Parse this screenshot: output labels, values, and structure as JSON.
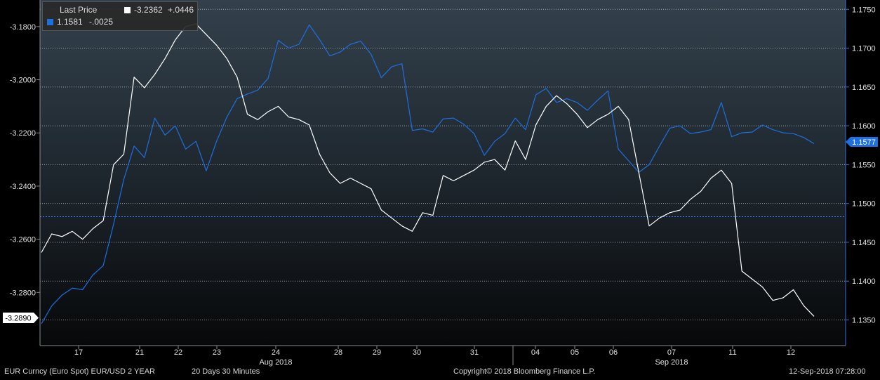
{
  "legend": {
    "title": "Last Price",
    "series": [
      {
        "color": "#ffffff",
        "last": "-3.2362",
        "change": "+.0446"
      },
      {
        "color": "#1e6fe0",
        "last": "1.1581",
        "change": "-.0025"
      }
    ]
  },
  "footer": {
    "ticker": "EUR Curncy (Euro Spot) EUR/USD 2 YEAR",
    "period": "20 Days 30 Minutes",
    "copyright": "Copyright© 2018 Bloomberg Finance L.P.",
    "timestamp": "12-Sep-2018 07:28:00"
  },
  "chart_data": {
    "type": "line",
    "x_ticks": [
      "17",
      "21",
      "22",
      "23",
      "24",
      "28",
      "29",
      "30",
      "31",
      "04",
      "05",
      "06",
      "07",
      "11",
      "12"
    ],
    "month_labels": [
      "Aug 2018",
      "Sep 2018"
    ],
    "left_axis": {
      "ylim": [
        -3.3,
        -3.17
      ],
      "ticks": [
        "-3.1800",
        "-3.2000",
        "-3.2200",
        "-3.2400",
        "-3.2600",
        "-3.2800"
      ]
    },
    "right_axis": {
      "ylim": [
        1.1317,
        1.1762
      ],
      "ticks": [
        "1.1750",
        "1.1700",
        "1.1650",
        "1.1600",
        "1.1550",
        "1.1500",
        "1.1450",
        "1.1400",
        "1.1350"
      ]
    },
    "badges": {
      "left_last": "-3.2890",
      "right_last": "1.1577"
    },
    "reference_line": 1.1483,
    "series": [
      {
        "axis": "left",
        "color": "#ffffff",
        "values": [
          -3.265,
          -3.258,
          -3.259,
          -3.257,
          -3.26,
          -3.256,
          -3.253,
          -3.232,
          -3.228,
          -3.199,
          -3.203,
          -3.198,
          -3.192,
          -3.185,
          -3.18,
          -3.179,
          -3.183,
          -3.187,
          -3.192,
          -3.199,
          -3.213,
          -3.215,
          -3.212,
          -3.21,
          -3.214,
          -3.215,
          -3.217,
          -3.228,
          -3.235,
          -3.239,
          -3.237,
          -3.239,
          -3.241,
          -3.249,
          -3.252,
          -3.255,
          -3.257,
          -3.25,
          -3.251,
          -3.236,
          -3.238,
          -3.236,
          -3.234,
          -3.231,
          -3.23,
          -3.234,
          -3.223,
          -3.23,
          -3.217,
          -3.21,
          -3.206,
          -3.209,
          -3.213,
          -3.218,
          -3.215,
          -3.213,
          -3.21,
          -3.215,
          -3.235,
          -3.255,
          -3.252,
          -3.25,
          -3.249,
          -3.245,
          -3.242,
          -3.237,
          -3.234,
          -3.239,
          -3.272,
          -3.275,
          -3.278,
          -3.283,
          -3.282,
          -3.279,
          -3.285,
          -3.289
        ]
      },
      {
        "axis": "right",
        "color": "#1e6fe0",
        "values": [
          1.1345,
          1.1368,
          1.1382,
          1.1391,
          1.1389,
          1.1408,
          1.142,
          1.1473,
          1.1531,
          1.1574,
          1.1559,
          1.161,
          1.1588,
          1.16,
          1.157,
          1.158,
          1.1542,
          1.158,
          1.1611,
          1.1635,
          1.1641,
          1.1646,
          1.1661,
          1.171,
          1.17,
          1.1705,
          1.173,
          1.1711,
          1.169,
          1.1695,
          1.1705,
          1.1709,
          1.1692,
          1.1662,
          1.1676,
          1.168,
          1.1594,
          1.1596,
          1.1592,
          1.1609,
          1.161,
          1.1602,
          1.159,
          1.1562,
          1.158,
          1.159,
          1.161,
          1.1595,
          1.164,
          1.1648,
          1.163,
          1.1635,
          1.163,
          1.162,
          1.1633,
          1.1645,
          1.157,
          1.1555,
          1.154,
          1.155,
          1.1574,
          1.1597,
          1.16,
          1.159,
          1.1592,
          1.1595,
          1.163,
          1.1586,
          1.1591,
          1.1592,
          1.1601,
          1.1595,
          1.1591,
          1.159,
          1.1585,
          1.1577
        ]
      }
    ]
  }
}
